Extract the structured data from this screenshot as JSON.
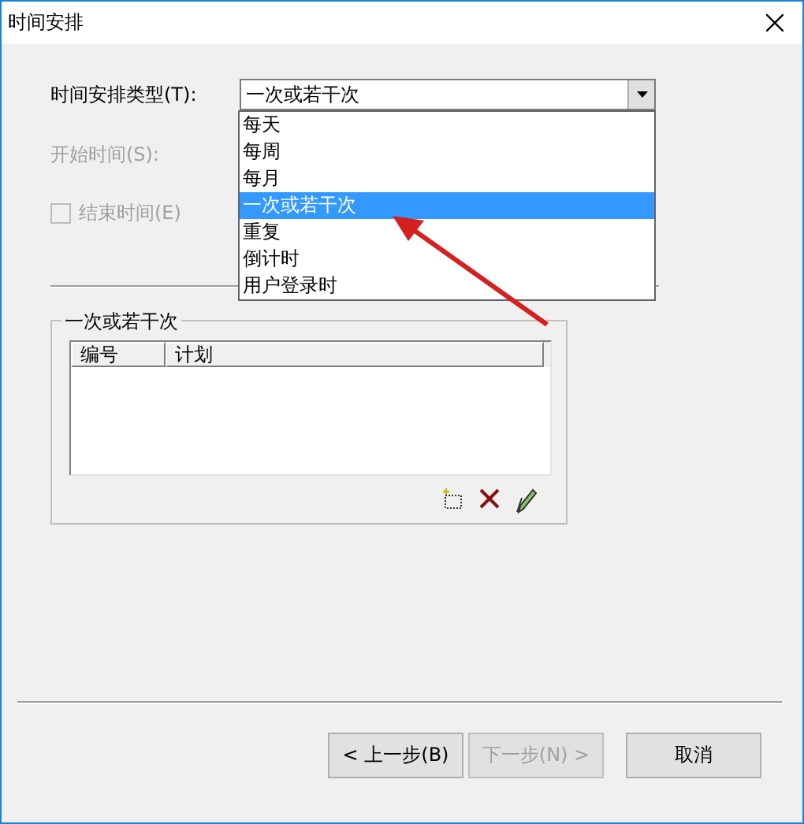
{
  "window": {
    "title": "时间安排"
  },
  "schedule_type": {
    "label": "时间安排类型(T):",
    "value": "一次或若干次",
    "expanded": true,
    "options": [
      {
        "label": "每天",
        "selected": false
      },
      {
        "label": "每周",
        "selected": false
      },
      {
        "label": "每月",
        "selected": false
      },
      {
        "label": "一次或若干次",
        "selected": true
      },
      {
        "label": "重复",
        "selected": false
      },
      {
        "label": "倒计时",
        "selected": false
      },
      {
        "label": "用户登录时",
        "selected": false
      }
    ]
  },
  "start_time": {
    "label": "开始时间(S):",
    "disabled": true
  },
  "end_time": {
    "label": "结束时间(E)",
    "checked": false,
    "disabled": true
  },
  "group": {
    "title": "一次或若干次",
    "columns": [
      "编号",
      "计划"
    ]
  },
  "buttons": [
    {
      "label": "< 上一步(B)",
      "disabled": false
    },
    {
      "label": "下一步(N) >",
      "disabled": true
    },
    {
      "label": "取消",
      "disabled": false
    }
  ]
}
